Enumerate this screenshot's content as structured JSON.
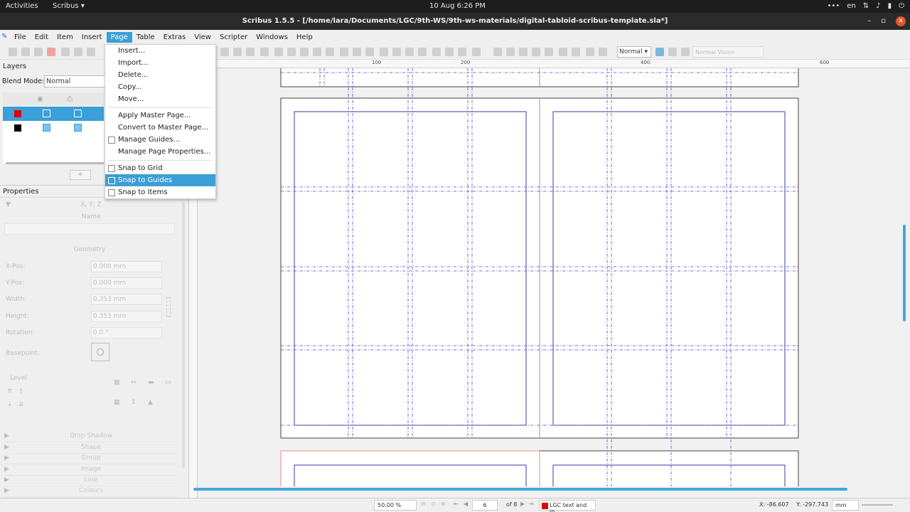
{
  "topbar": {
    "activities": "Activities",
    "app_name": "Scribus",
    "clock": "10 Aug  6:26 PM",
    "lang": "en"
  },
  "window": {
    "title": "Scribus 1.5.5 - [/home/lara/Documents/LGC/9th-WS/9th-ws-materials/digital-tabloid-scribus-template.sla*]"
  },
  "menubar": {
    "items": [
      "File",
      "Edit",
      "Item",
      "Insert",
      "Page",
      "Table",
      "Extras",
      "View",
      "Scripter",
      "Windows",
      "Help"
    ],
    "active": "Page"
  },
  "toolbar": {
    "render_mode": "Normal",
    "vision_mode": "Normal Vision"
  },
  "layers_panel": {
    "title": "Layers",
    "blend_label": "Blend Mode:",
    "blend_value": "Normal",
    "layers": [
      {
        "color": "#e00000",
        "selected": true
      },
      {
        "color": "#000000",
        "selected": false
      }
    ],
    "add_label": "+"
  },
  "properties_panel": {
    "title": "Properties",
    "xyz_header": "X, Y, Z",
    "name_label": "Name",
    "geometry_label": "Geometry",
    "fields": [
      {
        "label": "X-Pos:",
        "value": "0.000 mm"
      },
      {
        "label": "Y-Pos:",
        "value": "0.000 mm"
      },
      {
        "label": "Width:",
        "value": "0.353 mm"
      },
      {
        "label": "Height:",
        "value": "0.353 mm"
      },
      {
        "label": "Rotation:",
        "value": "0.0 °"
      }
    ],
    "basepoint_label": "Basepoint:",
    "level_label": "Level",
    "sections": [
      "Drop Shadow",
      "Shape",
      "Group",
      "Image",
      "Line",
      "Colours"
    ]
  },
  "page_menu": {
    "items": [
      {
        "label": "Insert...",
        "type": "item"
      },
      {
        "label": "Import...",
        "type": "item"
      },
      {
        "label": "Delete...",
        "type": "item"
      },
      {
        "label": "Copy...",
        "type": "item"
      },
      {
        "label": "Move...",
        "type": "item"
      },
      {
        "type": "separator"
      },
      {
        "label": "Apply Master Page...",
        "type": "item"
      },
      {
        "label": "Convert to Master Page...",
        "type": "item"
      },
      {
        "label": "Manage Guides...",
        "type": "item"
      },
      {
        "label": "Manage Page Properties...",
        "type": "item"
      },
      {
        "type": "separator"
      },
      {
        "label": "Snap to Grid",
        "type": "check"
      },
      {
        "label": "Snap to Guides",
        "type": "check",
        "highlighted": true
      },
      {
        "label": "Snap to Items",
        "type": "check"
      }
    ]
  },
  "ruler": {
    "ticks": [
      "100",
      "200",
      "300",
      "400",
      "500",
      "600",
      "700"
    ]
  },
  "statusbar": {
    "zoom": "50.00 %",
    "page_current": "6",
    "page_total": "of 8",
    "layer_name": "LGC text and in",
    "coord_x": "X: -86.607",
    "coord_y": "Y: -297.743",
    "unit": "mm"
  },
  "colors": {
    "accent": "#3b9fd8",
    "guide": "#3a3ab0",
    "margin": "#3a3ab0"
  }
}
